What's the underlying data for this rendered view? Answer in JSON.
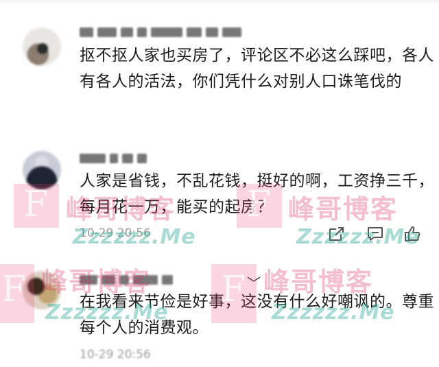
{
  "comments": [
    {
      "text": "抠不抠人家也买房了，评论区不必这么踩吧，各人有各人的活法，你们凭什么对别人口诛笔伐的",
      "username_blocks": [
        20,
        28,
        18,
        14,
        46,
        22,
        18,
        28
      ]
    },
    {
      "text": "人家是省钱，不乱花钱，挺好的啊，工资挣三千，每月花一万，能买的起房？",
      "timestamp": "10-29 20:56",
      "username_blocks": [
        38,
        12,
        16,
        14
      ]
    },
    {
      "text": "在我看来节俭是好事，这没有什么好嘲讽的。尊重每个人的消费观。",
      "timestamp": "10-29 20:56",
      "username_blocks": [
        26,
        20,
        14,
        36,
        16
      ],
      "reply_caret": "﹀"
    }
  ],
  "watermark": {
    "letter": "F",
    "brand": "峰哥博客",
    "url": "Zzzzzz.Me",
    "colors": {
      "pink": "#ec4070",
      "teal": "#2eaa96"
    }
  },
  "icons": [
    "share-icon",
    "comment-icon",
    "like-icon"
  ]
}
